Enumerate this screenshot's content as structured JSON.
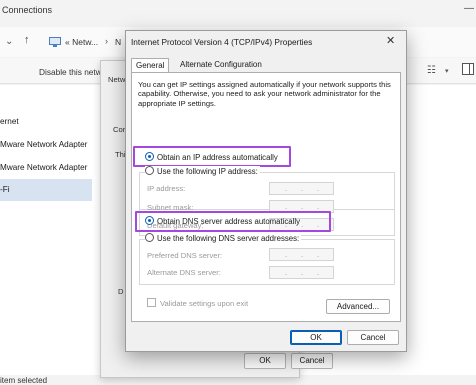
{
  "explorer": {
    "title": "Connections",
    "window_controls": "—",
    "nav": {
      "back": "←",
      "forward": "→",
      "chevron": "⌄",
      "up": "↑",
      "breadcrumb": "« Netw...",
      "breadcrumb_sep": "›",
      "breadcrumb_next": "N"
    },
    "toolbar": {
      "disable_label": "Disable this netw",
      "view_icon": "☷",
      "view_caret": "▾"
    },
    "items": [
      "ernet",
      "Mware Network Adapter",
      "Mware Network Adapter",
      "-Fi"
    ],
    "status": "item selected"
  },
  "mid_dialog": {
    "partial_labels": [
      "Netw",
      "Con",
      "This",
      "D"
    ],
    "ok": "OK",
    "cancel": "Cancel"
  },
  "dialog": {
    "title": "Internet Protocol Version 4 (TCP/IPv4) Properties",
    "close": "✕",
    "tabs": [
      "General",
      "Alternate Configuration"
    ],
    "description": "You can get IP settings assigned automatically if your network supports this capability. Otherwise, you need to ask your network administrator for the appropriate IP settings.",
    "ip_auto": "Obtain an IP address automatically",
    "ip_manual": "Use the following IP address:",
    "ip_fields": [
      "IP address:",
      "Subnet mask:",
      "Default gateway:"
    ],
    "dns_auto": "Obtain DNS server address automatically",
    "dns_manual": "Use the following DNS server addresses:",
    "dns_fields": [
      "Preferred DNS server:",
      "Alternate DNS server:"
    ],
    "validate": "Validate settings upon exit",
    "advanced": "Advanced...",
    "ok": "OK",
    "cancel": "Cancel",
    "ip_dots": "."
  },
  "colors": {
    "highlight": "#a448e0",
    "accent": "#0a5fb4"
  }
}
